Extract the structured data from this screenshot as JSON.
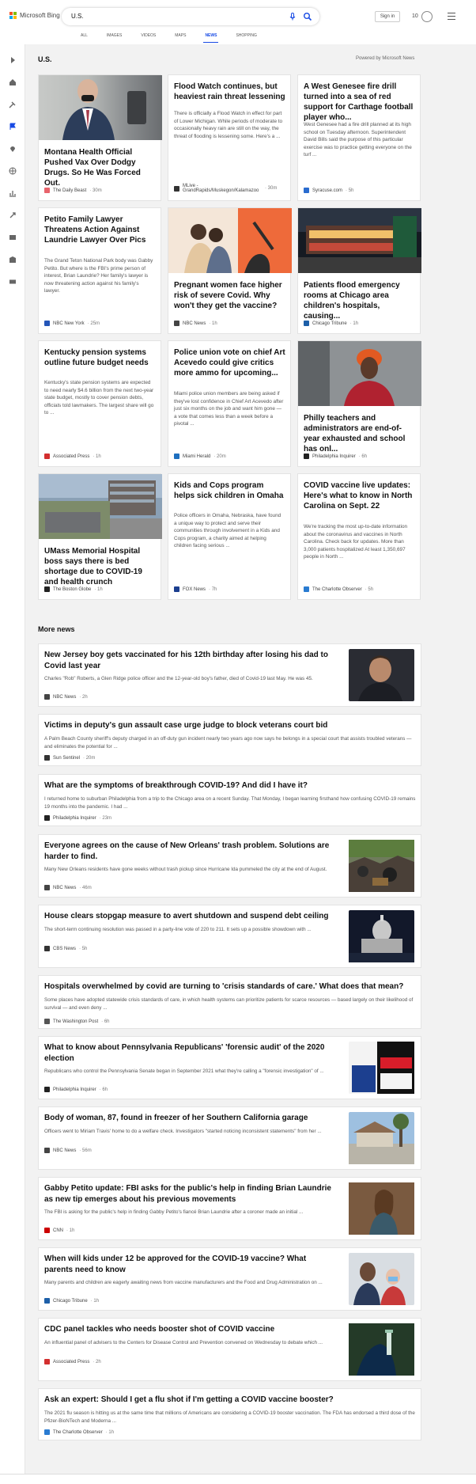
{
  "header": {
    "brand": "Microsoft Bing",
    "query": "U.S.",
    "sign_in": "Sign in",
    "rewards_count": "10",
    "tabs": [
      "ALL",
      "IMAGES",
      "VIDEOS",
      "MAPS",
      "NEWS",
      "SHOPPING"
    ],
    "active_tab": "NEWS"
  },
  "section": {
    "title": "U.S.",
    "powered_by": "Powered by Microsoft News"
  },
  "cards": [
    {
      "headline": "Montana Health Official Pushed Vax Over Dodgy Drugs. So He Was Forced Out.",
      "snippet": "",
      "source": "The Daily Beast",
      "time": "30m",
      "logo_color": "#e8646c"
    },
    {
      "headline": "Flood Watch continues, but heaviest rain threat lessening",
      "snippet": "There is officially a Flood Watch in effect for part of Lower Michigan. While periods of moderate to occasionally heavy rain are still on the way, the threat of flooding is lessening some. Here's a ...",
      "source": "MLive - GrandRapids/Muskegon/Kalamazoo",
      "time": "30m",
      "logo_color": "#333333"
    },
    {
      "headline": "A West Genesee fire drill turned into a sea of red support for Carthage football player who...",
      "snippet": "West Genesee had a fire drill planned at its high school on Tuesday afternoon. Superintendent David Bills said the purpose of this particular exercise was to practice getting everyone on the turf ...",
      "source": "Syracuse.com",
      "time": "5h",
      "logo_color": "#2a6ccf"
    },
    {
      "headline": "Petito Family Lawyer Threatens Action Against Laundrie Lawyer Over Pics",
      "snippet": "The Grand Teton National Park body was Gabby Petito. But where is the FBI's prime person of interest, Brian Laundrie? Her family's lawyer is now threatening action against his family's lawyer.",
      "source": "NBC New York",
      "time": "25m",
      "logo_color": "#2455b8"
    },
    {
      "headline": "Pregnant women face higher risk of severe Covid. Why won't they get the vaccine?",
      "snippet": "",
      "source": "NBC News",
      "time": "1h",
      "logo_color": "#444444"
    },
    {
      "headline": "Patients flood emergency rooms at Chicago area children's hospitals, causing...",
      "snippet": "",
      "source": "Chicago Tribune",
      "time": "1h",
      "logo_color": "#1d5fa8"
    },
    {
      "headline": "Kentucky pension systems outline future budget needs",
      "snippet": "Kentucky's state pension systems are expected to need nearly $4.6 billion from the next two-year state budget, mostly to cover pension debts, officials told lawmakers. The largest share will go to ...",
      "source": "Associated Press",
      "time": "1h",
      "logo_color": "#d32f2f"
    },
    {
      "headline": "Police union vote on chief Art Acevedo could give critics more ammo for upcoming...",
      "snippet": "Miami police union members are being asked if they've lost confidence in Chief Art Acevedo after just six months on the job and want him gone — a vote that comes less than a week before a pivotal ...",
      "source": "Miami Herald",
      "time": "20m",
      "logo_color": "#1f6fbf"
    },
    {
      "headline": "Philly teachers and administrators are end-of-year exhausted and school has onl...",
      "snippet": "",
      "source": "Philadelphia Inquirer",
      "time": "6h",
      "logo_color": "#222222"
    },
    {
      "headline": "UMass Memorial Hospital boss says there is bed shortage due to COVID-19 and health crunch",
      "snippet": "",
      "source": "The Boston Globe",
      "time": "1h",
      "logo_color": "#222222"
    },
    {
      "headline": "Kids and Cops program helps sick children in Omaha",
      "snippet": "Police officers in Omaha, Nebraska, have found a unique way to protect and serve their communities through involvement in a Kids and Cops program, a charity aimed at helping children facing serious ...",
      "source": "FOX News",
      "time": "7h",
      "logo_color": "#1c3f8f"
    },
    {
      "headline": "COVID vaccine live updates: Here's what to know in North Carolina on Sept. 22",
      "snippet": "We're tracking the most up-to-date information about the coronavirus and vaccines in North Carolina. Check back for updates. More than 3,000 patients hospitalized At least 1,350,697 people in North ...",
      "source": "The Charlotte Observer",
      "time": "5h",
      "logo_color": "#2a7bd1"
    }
  ],
  "more_news": {
    "title": "More news",
    "items": [
      {
        "headline": "New Jersey boy gets vaccinated for his 12th birthday after losing his dad to Covid last year",
        "snippet": "Charles \"Rob\" Roberts, a Glen Ridge police officer and the 12-year-old boy's father, died of Covid-19 last May. He was 45.",
        "source": "NBC News",
        "time": "2h",
        "logo_color": "#444444",
        "thumb": true
      },
      {
        "headline": "Victims in deputy's gun assault case urge judge to block veterans court bid",
        "snippet": "A Palm Beach County sheriff's deputy charged in an off-duty gun incident nearly two years ago now says he belongs in a special court that assists troubled veterans — and eliminates the potential for ...",
        "source": "Sun Sentinel",
        "time": "20m",
        "logo_color": "#333333",
        "thumb": false
      },
      {
        "headline": "What are the symptoms of breakthrough COVID-19? And did I have it?",
        "snippet": "I returned home to suburban Philadelphia from a trip to the Chicago area on a recent Sunday. That Monday, I began learning firsthand how confusing COVID-19 remains 19 months into the pandemic. I had ...",
        "source": "Philadelphia Inquirer",
        "time": "23m",
        "logo_color": "#222222",
        "thumb": false
      },
      {
        "headline": "Everyone agrees on the cause of New Orleans' trash problem. Solutions are harder to find.",
        "snippet": "Many New Orleans residents have gone weeks without trash pickup since Hurricane Ida pummeled the city at the end of August.",
        "source": "NBC News",
        "time": "46m",
        "logo_color": "#444444",
        "thumb": true
      },
      {
        "headline": "House clears stopgap measure to avert shutdown and suspend debt ceiling",
        "snippet": "The short-term continuing resolution was passed in a party-line vote of 220 to 211. It sets up a possible showdown with ...",
        "source": "CBS News",
        "time": "5h",
        "logo_color": "#333333",
        "thumb": true
      },
      {
        "headline": "Hospitals overwhelmed by covid are turning to 'crisis standards of care.' What does that mean?",
        "snippet": "Some places have adopted statewide crisis standards of care, in which health systems can prioritize patients for scarce resources — based largely on their likelihood of survival — and even deny ...",
        "source": "The Washington Post",
        "time": "6h",
        "logo_color": "#555555",
        "thumb": false
      },
      {
        "headline": "What to know about Pennsylvania Republicans' 'forensic audit' of the 2020 election",
        "snippet": "Republicans who control the Pennsylvania Senate began in September 2021 what they're calling a \"forensic investigation\" of ...",
        "source": "Philadelphia Inquirer",
        "time": "6h",
        "logo_color": "#222222",
        "thumb": true
      },
      {
        "headline": "Body of woman, 87, found in freezer of her Southern California garage",
        "snippet": "Officers went to Miriam Travis' home to do a welfare check. Investigators \"started noticing inconsistent statements\" from her ...",
        "source": "NBC News",
        "time": "56m",
        "logo_color": "#444444",
        "thumb": true
      },
      {
        "headline": "Gabby Petito update: FBI asks for the public's help in finding Brian Laundrie as new tip emerges about his previous movements",
        "snippet": "The FBI is asking for the public's help in finding Gabby Petito's fiancé Brian Laundrie after a coroner made an initial ...",
        "source": "CNN",
        "time": "1h",
        "logo_color": "#cc0000",
        "thumb": true
      },
      {
        "headline": "When will kids under 12 be approved for the COVID-19 vaccine? What parents need to know",
        "snippet": "Many parents and children are eagerly awaiting news from vaccine manufacturers and the Food and Drug Administration on ...",
        "source": "Chicago Tribune",
        "time": "1h",
        "logo_color": "#1d5fa8",
        "thumb": true
      },
      {
        "headline": "CDC panel tackles who needs booster shot of COVID vaccine",
        "snippet": "An influential panel of advisers to the Centers for Disease Control and Prevention convened on Wednesday to debate which ...",
        "source": "Associated Press",
        "time": "2h",
        "logo_color": "#d32f2f",
        "thumb": true
      },
      {
        "headline": "Ask an expert: Should I get a flu shot if I'm getting a COVID vaccine booster?",
        "snippet": "The 2021 flu season is hitting us at the same time that millions of Americans are considering a COVID-19 booster vaccination. The FDA has endorsed a third dose of the Pfizer-BioNTech and Moderna ...",
        "source": "The Charlotte Observer",
        "time": "1h",
        "logo_color": "#2a7bd1",
        "thumb": false
      }
    ]
  },
  "colors": {
    "accent": "#174ae4",
    "page_bg": "#f2f2f2"
  }
}
